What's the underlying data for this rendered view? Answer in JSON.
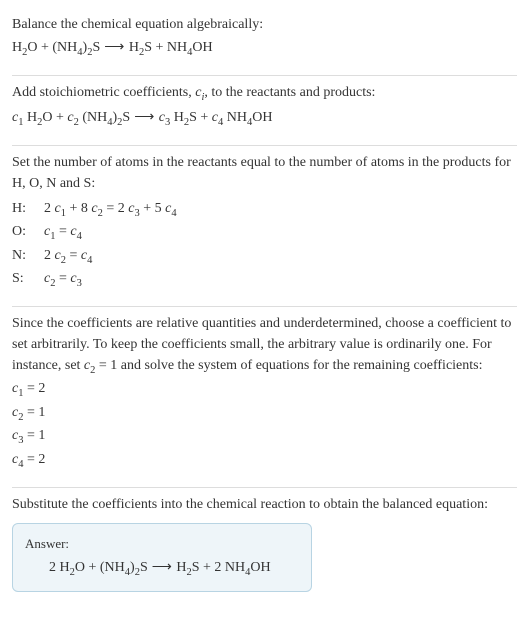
{
  "sections": {
    "intro": {
      "heading": "Balance the chemical equation algebraically:",
      "equation_parts": {
        "r1": "H",
        "r1s": "2",
        "r1b": "O + (NH",
        "r1s2": "4",
        "r1c": ")",
        "r1s3": "2",
        "r1d": "S",
        "arrow": " ⟶ ",
        "p1": "H",
        "p1s": "2",
        "p1b": "S + NH",
        "p1s2": "4",
        "p1c": "OH"
      }
    },
    "stoich": {
      "heading_a": "Add stoichiometric coefficients, ",
      "heading_var": "c",
      "heading_sub": "i",
      "heading_b": ", to the reactants and products:",
      "coef": {
        "c1": "c",
        "c1s": "1",
        "sp1": " H",
        "sp1s": "2",
        "sp1b": "O + ",
        "c2": "c",
        "c2s": "2",
        "sp2": " (NH",
        "sp2s": "4",
        "sp2b": ")",
        "sp2s2": "2",
        "sp2c": "S",
        "arrow": " ⟶ ",
        "c3": "c",
        "c3s": "3",
        "sp3": " H",
        "sp3s": "2",
        "sp3b": "S + ",
        "c4": "c",
        "c4s": "4",
        "sp4": " NH",
        "sp4s": "4",
        "sp4b": "OH"
      }
    },
    "atoms": {
      "heading": "Set the number of atoms in the reactants equal to the number of atoms in the products for H, O, N and S:",
      "rows": {
        "H": {
          "label": "H:",
          "lhs_a": "2 ",
          "lhs_b": " + 8 ",
          "rhs_a": " = 2 ",
          "rhs_b": " + 5 "
        },
        "O": {
          "label": "O:",
          "eq_mid": " = "
        },
        "N": {
          "label": "N:",
          "lhs_a": "2 ",
          "eq_mid": " = "
        },
        "S": {
          "label": " S:",
          "eq_mid": " = "
        }
      },
      "vars": {
        "c1": "c",
        "s1": "1",
        "c2": "c",
        "s2": "2",
        "c3": "c",
        "s3": "3",
        "c4": "c",
        "s4": "4"
      }
    },
    "solve": {
      "text_a": "Since the coefficients are relative quantities and underdetermined, choose a coefficient to set arbitrarily. To keep the coefficients small, the arbitrary value is ordinarily one. For instance, set ",
      "text_var": "c",
      "text_sub": "2",
      "text_b": " = 1 and solve the system of equations for the remaining coefficients:",
      "results": {
        "r1_a": "c",
        "r1_s": "1",
        "r1_b": " = 2",
        "r2_a": "c",
        "r2_s": "2",
        "r2_b": " = 1",
        "r3_a": "c",
        "r3_s": "3",
        "r3_b": " = 1",
        "r4_a": "c",
        "r4_s": "4",
        "r4_b": " = 2"
      }
    },
    "final": {
      "heading": "Substitute the coefficients into the chemical reaction to obtain the balanced equation:",
      "answer_label": "Answer:",
      "eq": {
        "a": "2 H",
        "as": "2",
        "b": "O + (NH",
        "bs": "4",
        "c": ")",
        "cs": "2",
        "d": "S",
        "arrow": " ⟶ ",
        "e": "H",
        "es": "2",
        "f": "S + 2 NH",
        "fs": "4",
        "g": "OH"
      }
    }
  }
}
